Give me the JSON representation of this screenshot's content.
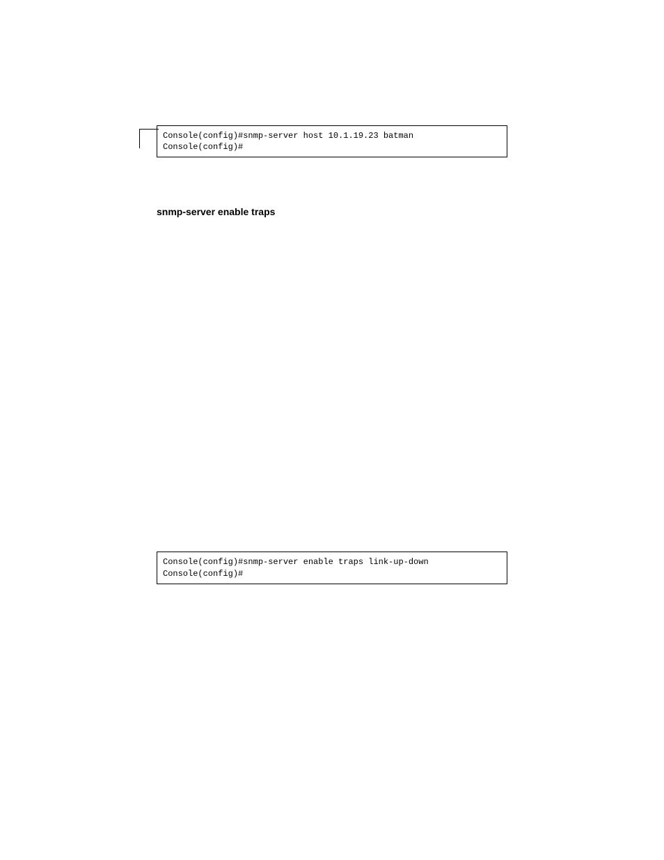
{
  "codebox1": {
    "line1": "Console(config)#snmp-server host 10.1.19.23 batman",
    "line2": "Console(config)#"
  },
  "heading1": "snmp-server enable traps",
  "codebox2": {
    "line1": "Console(config)#snmp-server enable traps link-up-down",
    "line2": "Console(config)#"
  }
}
